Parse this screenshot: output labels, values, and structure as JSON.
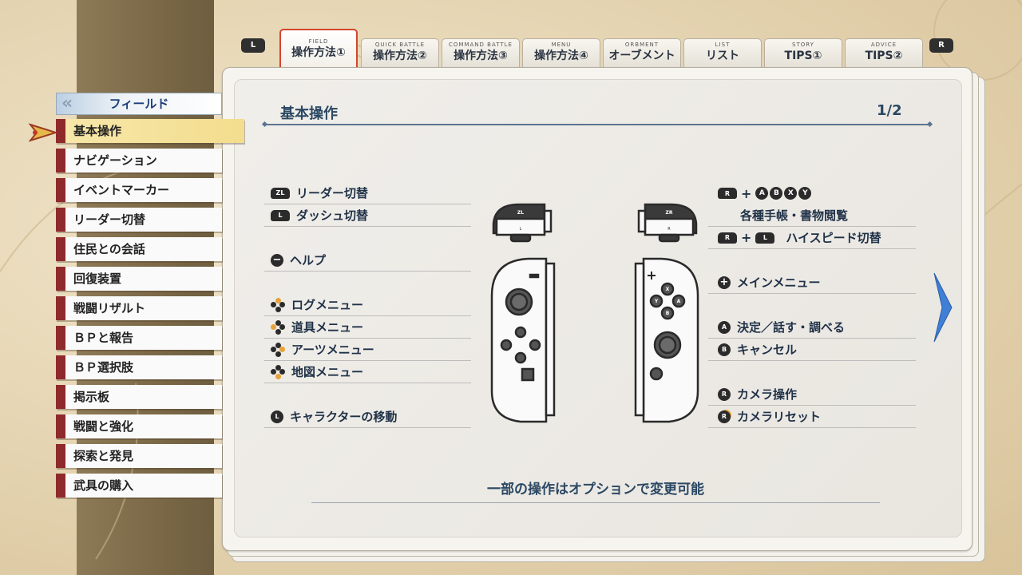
{
  "tabs": {
    "shoulder_left": "L",
    "shoulder_right": "R",
    "items": [
      {
        "sub": "FIELD",
        "label": "操作方法①",
        "active": true
      },
      {
        "sub": "QUICK BATTLE",
        "label": "操作方法②"
      },
      {
        "sub": "COMMAND BATTLE",
        "label": "操作方法③"
      },
      {
        "sub": "MENU",
        "label": "操作方法④"
      },
      {
        "sub": "ORBMENT",
        "label": "オーブメント"
      },
      {
        "sub": "LIST",
        "label": "リスト"
      },
      {
        "sub": "STORY",
        "label": "TIPS①"
      },
      {
        "sub": "ADVICE",
        "label": "TIPS②"
      }
    ]
  },
  "sidebar": {
    "header": "フィールド",
    "selected_index": 0,
    "items": [
      "基本操作",
      "ナビゲーション",
      "イベントマーカー",
      "リーダー切替",
      "住民との会話",
      "回復装置",
      "戦闘リザルト",
      "ＢＰと報告",
      "ＢＰ選択肢",
      "掲示板",
      "戦闘と強化",
      "探索と発見",
      "武具の購入"
    ]
  },
  "main": {
    "title": "基本操作",
    "page": "1/2",
    "left_controls": [
      {
        "icon": "zl-button",
        "glyph": "ZL",
        "label": "リーダー切替"
      },
      {
        "icon": "l-button",
        "glyph": "L",
        "label": "ダッシュ切替"
      },
      {
        "icon": "minus-button",
        "glyph": "−",
        "label": "ヘルプ"
      },
      {
        "icon": "dpad-up",
        "label": "ログメニュー"
      },
      {
        "icon": "dpad-left",
        "label": "道具メニュー"
      },
      {
        "icon": "dpad-right",
        "label": "アーツメニュー"
      },
      {
        "icon": "dpad-down",
        "label": "地図メニュー"
      },
      {
        "icon": "left-stick",
        "glyph": "L",
        "label": "キャラクターの移動"
      }
    ],
    "right_controls": {
      "combo1_prefix": "R",
      "combo1_plus": "+",
      "combo1_buttons": [
        "A",
        "B",
        "X",
        "Y"
      ],
      "combo1_label": "各種手帳・書物閲覧",
      "combo2_a": "R",
      "combo2_plus": "+",
      "combo2_b": "L",
      "combo2_label": "ハイスピード切替",
      "items": [
        {
          "icon": "plus-button",
          "glyph": "+",
          "label": "メインメニュー"
        },
        {
          "icon": "a-button",
          "glyph": "A",
          "label": "決定／話す・調べる"
        },
        {
          "icon": "b-button",
          "glyph": "B",
          "label": "キャンセル"
        },
        {
          "icon": "right-stick",
          "glyph": "R",
          "label": "カメラ操作"
        },
        {
          "icon": "right-stick-press",
          "glyph": "R",
          "label": "カメラリセット"
        }
      ]
    },
    "controller_labels": {
      "zl": "ZL",
      "l": "L",
      "zr": "ZR",
      "r": "R",
      "x": "X",
      "y": "Y",
      "a": "A",
      "b": "B"
    },
    "footer_note": "一部の操作はオプションで変更可能"
  },
  "colors": {
    "accent_red": "#d2462f",
    "title_blue": "#2b4863",
    "menu_red": "#8f2a2c",
    "selected_gold": "#f3dd8e",
    "arrow_blue": "#3f7fd6"
  }
}
